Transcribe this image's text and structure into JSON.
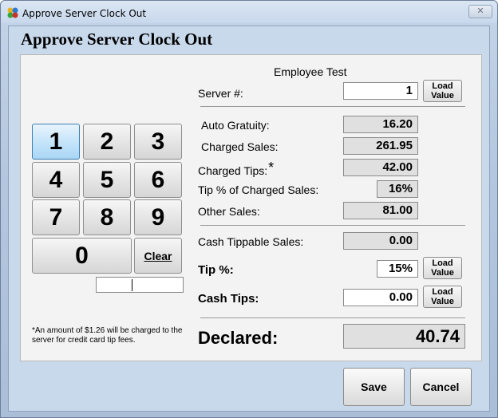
{
  "window": {
    "title": "Approve Server Clock Out",
    "close_glyph": "✕"
  },
  "header": {
    "title": "Approve Server Clock Out"
  },
  "keypad": {
    "keys": [
      "1",
      "2",
      "3",
      "4",
      "5",
      "6",
      "7",
      "8",
      "9",
      "0"
    ],
    "clear_label": "Clear",
    "display_value": ""
  },
  "note": "*An amount of $1.26 will be charged to the server for credit card tip fees.",
  "employee_name": "Employee Test",
  "server": {
    "label": "Server #:",
    "value": "1",
    "load_label_line1": "Load",
    "load_label_line2": "Value"
  },
  "auto_gratuity": {
    "label": "Auto Gratuity:",
    "value": "16.20"
  },
  "charged_sales": {
    "label": "Charged Sales:",
    "value": "261.95"
  },
  "charged_tips": {
    "label": "Charged Tips:",
    "marker": "*",
    "value": "42.00"
  },
  "tip_pct_charged": {
    "label": "Tip % of Charged Sales:",
    "value": "16%"
  },
  "other_sales": {
    "label": "Other Sales:",
    "value": "81.00"
  },
  "cash_tippable": {
    "label": "Cash Tippable Sales:",
    "value": "0.00"
  },
  "tip_pct": {
    "label": "Tip %:",
    "value": "15%",
    "load_label_line1": "Load",
    "load_label_line2": "Value"
  },
  "cash_tips": {
    "label": "Cash Tips:",
    "value": "0.00",
    "load_label_line1": "Load",
    "load_label_line2": "Value"
  },
  "declared": {
    "label": "Declared:",
    "value": "40.74"
  },
  "buttons": {
    "save": "Save",
    "cancel": "Cancel"
  },
  "colors": {
    "accent_key": "#c3e3fa",
    "window_frame": "#b5c7df",
    "readonly_field": "#e0e0e0"
  },
  "icons": {
    "app": "multicolor-app-icon",
    "close": "close-icon"
  }
}
